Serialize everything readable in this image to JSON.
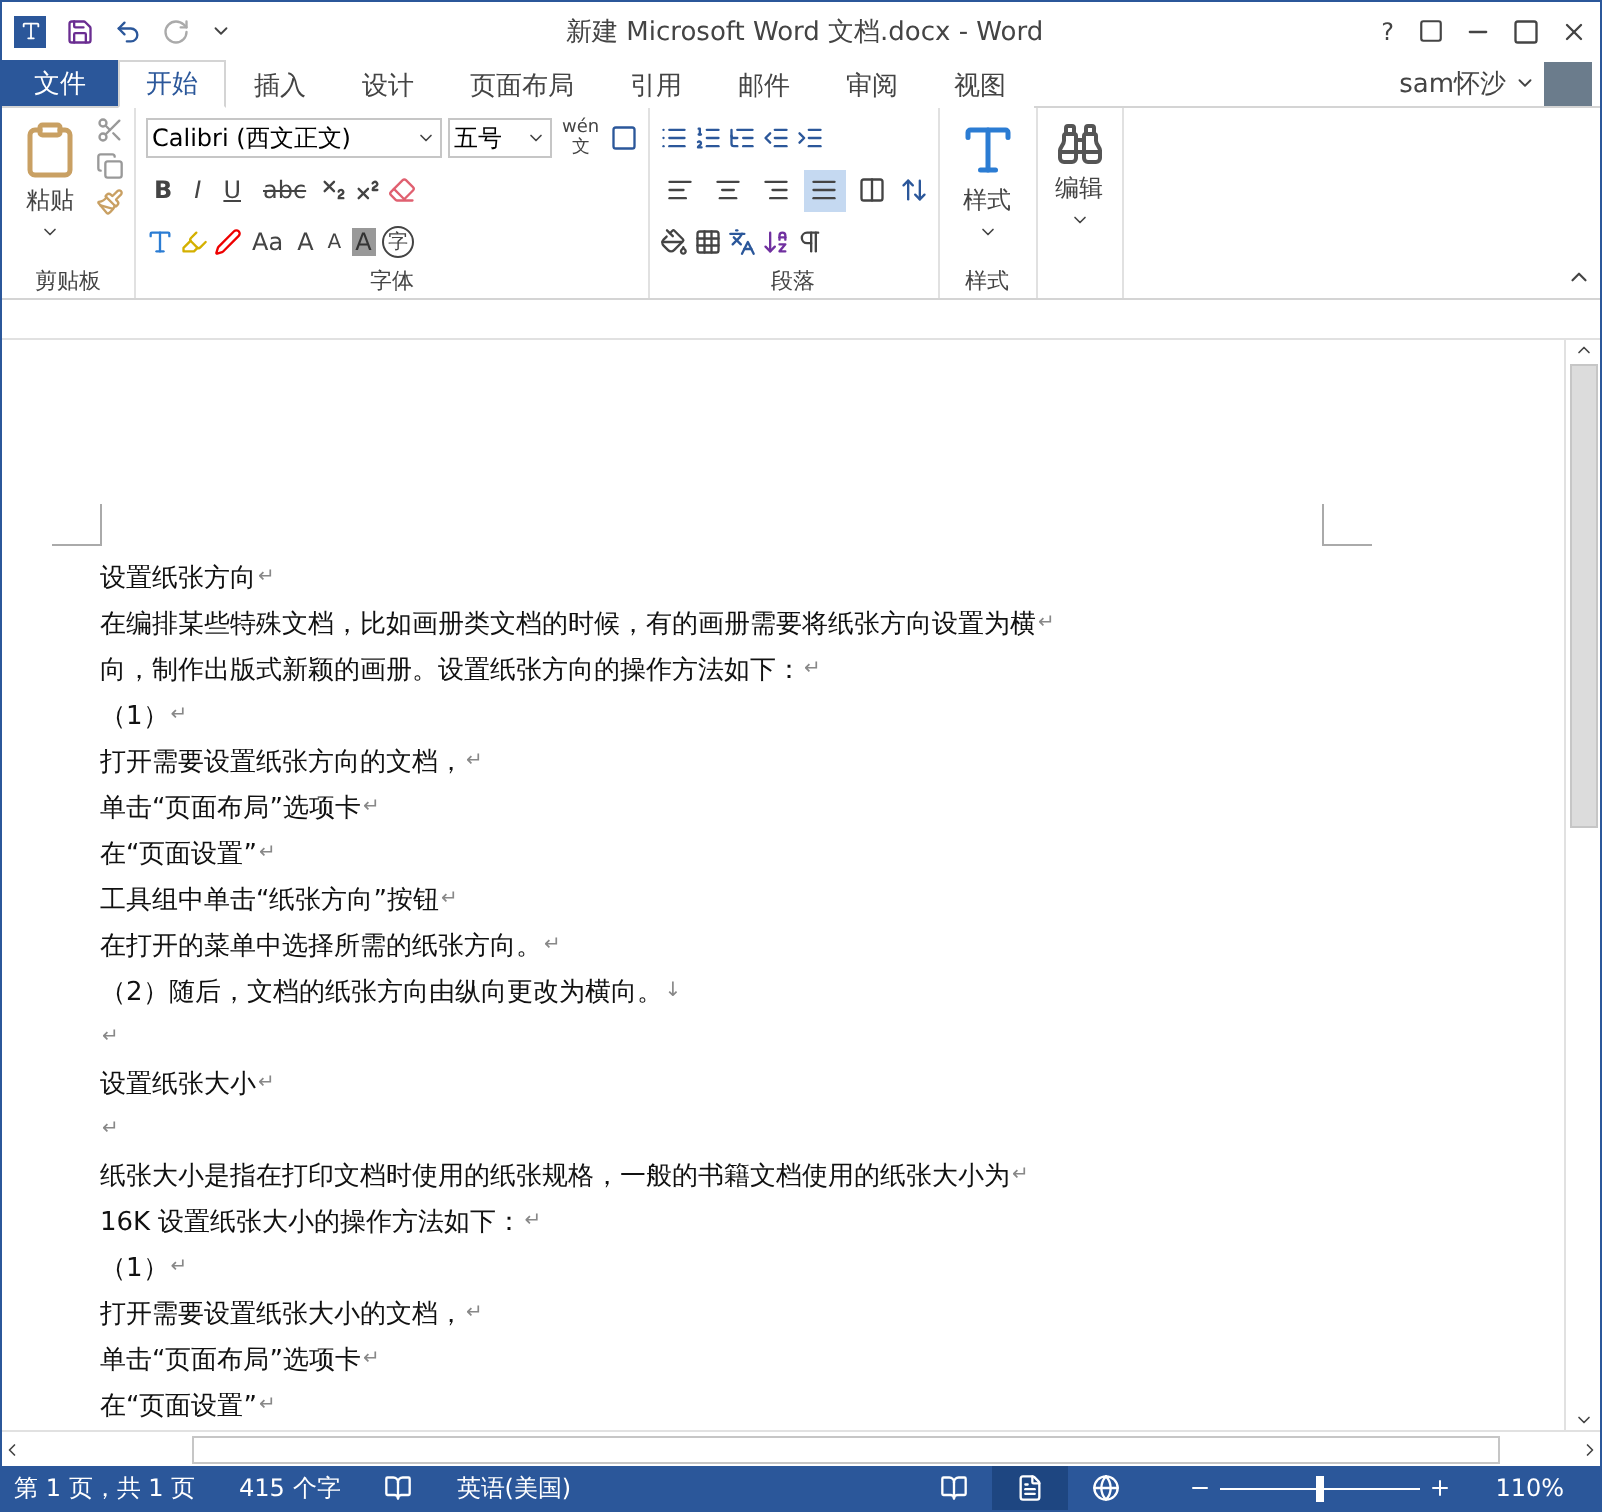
{
  "title_bar": {
    "title": "新建 Microsoft Word 文档.docx - Word",
    "help": "?"
  },
  "file_tab": "文件",
  "tabs": [
    {
      "label": "开始",
      "selected": true
    },
    {
      "label": "插入",
      "selected": false
    },
    {
      "label": "设计",
      "selected": false
    },
    {
      "label": "页面布局",
      "selected": false
    },
    {
      "label": "引用",
      "selected": false
    },
    {
      "label": "邮件",
      "selected": false
    },
    {
      "label": "审阅",
      "selected": false
    },
    {
      "label": "视图",
      "selected": false
    }
  ],
  "user": {
    "name": "sam怀沙"
  },
  "ribbon": {
    "clipboard": {
      "paste": "粘贴",
      "label": "剪贴板"
    },
    "font": {
      "label": "字体",
      "font_name": "Calibri (西文正文)",
      "font_size": "五号",
      "phonetic": "wén",
      "phonetic_char": "文",
      "styles": [
        "B",
        "I",
        "U",
        "abc"
      ],
      "grow": "A",
      "shrink": "A",
      "change_case": "Aa",
      "enclose": "字",
      "shade": "A"
    },
    "paragraph": {
      "label": "段落",
      "alignments": [
        {
          "kind": "left",
          "selected": false
        },
        {
          "kind": "center",
          "selected": false
        },
        {
          "kind": "right",
          "selected": false
        },
        {
          "kind": "justify",
          "selected": true
        },
        {
          "kind": "distributed",
          "selected": false
        }
      ]
    },
    "styles": {
      "button": "样式",
      "label": "样式"
    },
    "editing": {
      "button": "编辑"
    }
  },
  "document": {
    "lines": [
      {
        "text": "设置纸张方向",
        "mark": "↵"
      },
      {
        "text": "在编排某些特殊文档，比如画册类文档的时候，有的画册需要将纸张方向设置为横",
        "mark": "↵"
      },
      {
        "text": "向，制作出版式新颖的画册。设置纸张方向的操作方法如下：",
        "mark": "↵"
      },
      {
        "text": "（1）",
        "mark": "↵"
      },
      {
        "text": "打开需要设置纸张方向的文档，",
        "mark": "↵"
      },
      {
        "text": "单击“页面布局”选项卡",
        "mark": "↵"
      },
      {
        "text": "在“页面设置”",
        "mark": "↵"
      },
      {
        "text": "工具组中单击“纸张方向”按钮",
        "mark": "↵"
      },
      {
        "text": "在打开的菜单中选择所需的纸张方向。",
        "mark": "↵"
      },
      {
        "text": "（2）随后，文档的纸张方向由纵向更改为横向。",
        "mark": "↓"
      },
      {
        "mark": "↵"
      },
      {
        "text": "设置纸张大小",
        "mark": "↵"
      },
      {
        "mark": "↵"
      },
      {
        "text": "纸张大小是指在打印文档时使用的纸张规格，一般的书籍文档使用的纸张大小为",
        "mark": "↵"
      },
      {
        "text": "16K 设置纸张大小的操作方法如下：",
        "mark": "↵"
      },
      {
        "text": "（1）",
        "mark": "↵"
      },
      {
        "text": "打开需要设置纸张大小的文档，",
        "mark": "↵"
      },
      {
        "text": "单击“页面布局”选项卡",
        "mark": "↵"
      },
      {
        "text": "在“页面设置”",
        "mark": "↵"
      }
    ]
  },
  "status_bar": {
    "page": "第 1 页，共 1 页",
    "words": "415 个字",
    "language": "英语(美国)",
    "views": [
      {
        "kind": "read",
        "selected": false
      },
      {
        "kind": "print",
        "selected": true
      },
      {
        "kind": "web",
        "selected": false
      }
    ],
    "zoom": {
      "level": 0.5,
      "reading": "110%"
    }
  }
}
